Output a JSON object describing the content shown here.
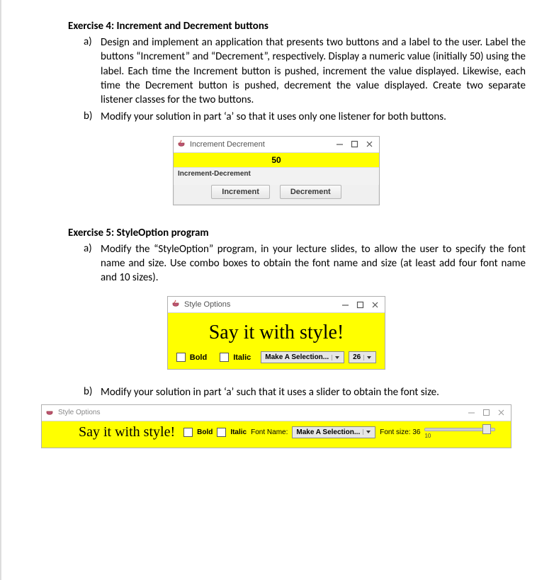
{
  "exercise4": {
    "heading": "Exercise 4: Increment and Decrement buttons",
    "a_marker": "a)",
    "a_text": "Design and implement an application that presents two buttons and a label to the user. Label the buttons “Increment” and “Decrement”, respectively. Display a numeric value (initially 50) using the label. Each time the Increment button is pushed, increment the value displayed. Likewise, each time the Decrement button is pushed, decrement the value displayed. Create two separate listener classes for the two buttons.",
    "b_marker": "b)",
    "b_text": "Modify your solution in part ‘a’ so that it uses only one listener for both buttons."
  },
  "incdec_win": {
    "title": "Increment Decrement",
    "value": "50",
    "toolbar_label": "Increment-Decrement",
    "btn_inc": "Increment",
    "btn_dec": "Decrement"
  },
  "exercise5": {
    "heading": "Exercise 5: StyleOption program",
    "a_marker": "a)",
    "a_text": "Modify the “StyleOption” program, in your lecture slides, to allow the user to specify the font name and size. Use combo boxes to obtain the font name and size (at least add four font name and 10 sizes).",
    "b_marker": "b)",
    "b_text": "Modify your solution in part ‘a’ such that it uses a slider to obtain the font size."
  },
  "style_win": {
    "title": "Style Options",
    "headline": "Say it with style!",
    "bold_label": "Bold",
    "italic_label": "Italic",
    "font_combo": "Make A Selection...",
    "size_combo": "26"
  },
  "style_wide": {
    "title": "Style Options",
    "headline": "Say it with style!",
    "bold_label": "Bold",
    "italic_label": "Italic",
    "font_name_lbl": "Font Name:",
    "font_combo": "Make A Selection...",
    "font_size_lbl": "Font size: 36",
    "slider_tick": "10"
  }
}
